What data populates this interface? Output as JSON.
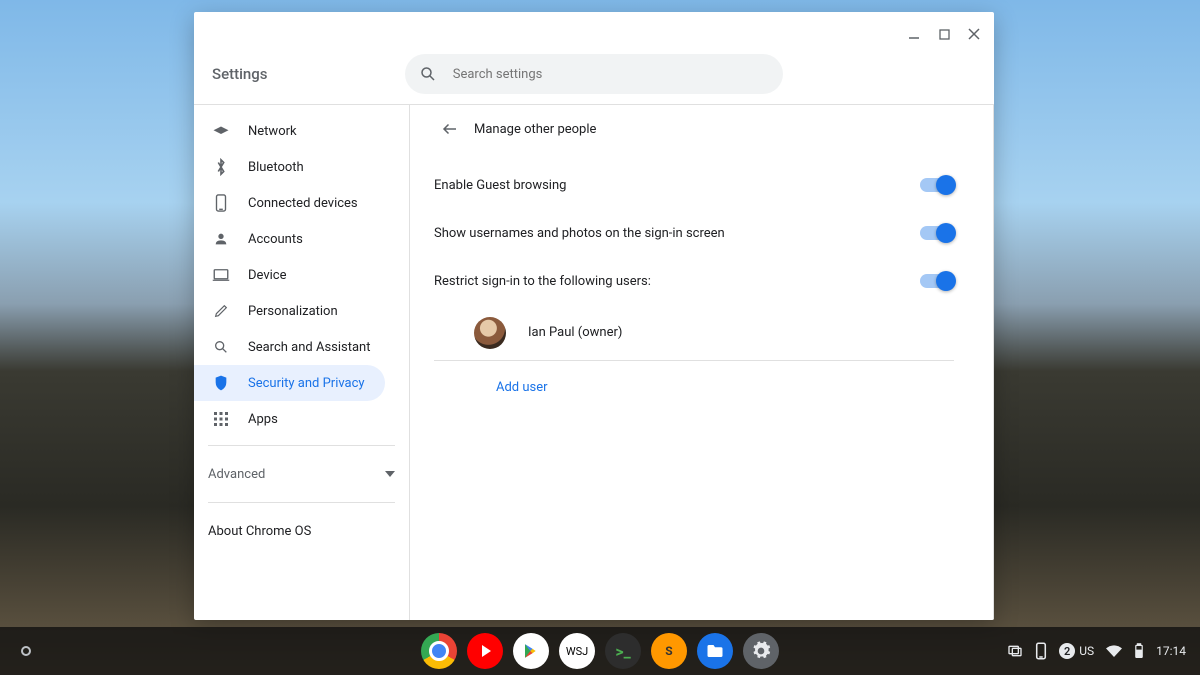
{
  "window": {
    "title": "Settings",
    "search_placeholder": "Search settings"
  },
  "sidebar": {
    "items": [
      {
        "label": "Network"
      },
      {
        "label": "Bluetooth"
      },
      {
        "label": "Connected devices"
      },
      {
        "label": "Accounts"
      },
      {
        "label": "Device"
      },
      {
        "label": "Personalization"
      },
      {
        "label": "Search and Assistant"
      },
      {
        "label": "Security and Privacy"
      },
      {
        "label": "Apps"
      }
    ],
    "advanced_label": "Advanced",
    "about_label": "About Chrome OS"
  },
  "page": {
    "title": "Manage other people",
    "rows": [
      {
        "label": "Enable Guest browsing"
      },
      {
        "label": "Show usernames and photos on the sign-in screen"
      },
      {
        "label": "Restrict sign-in to the following users:"
      }
    ],
    "user_label": "Ian Paul (owner)",
    "add_user_label": "Add user"
  },
  "shelf": {
    "apps": [
      "Chrome",
      "YouTube",
      "Play Store",
      "WSJ",
      "Terminal",
      "Sublime",
      "Files",
      "Settings"
    ],
    "wsj_text": "WSJ",
    "notif_count": "2",
    "ime_label": "US",
    "clock": "17:14"
  }
}
